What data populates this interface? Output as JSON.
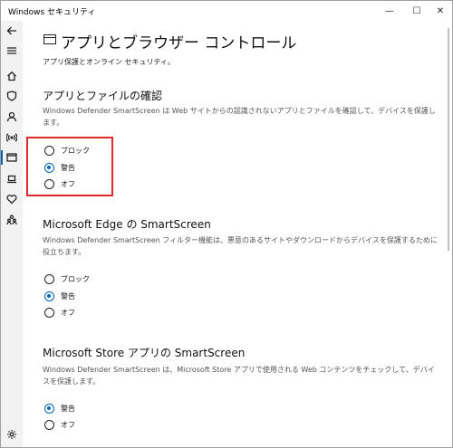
{
  "window": {
    "title": "Windows セキュリティ",
    "controls": {
      "minimize": "—",
      "maximize": "☐",
      "close": "✕"
    }
  },
  "sidebar": {
    "items": [
      {
        "icon": "back-arrow-icon"
      },
      {
        "icon": "hamburger-menu-icon"
      },
      {
        "icon": "home-icon"
      },
      {
        "icon": "shield-icon"
      },
      {
        "icon": "person-icon"
      },
      {
        "icon": "wireless-icon"
      },
      {
        "icon": "app-browser-icon",
        "active": true
      },
      {
        "icon": "laptop-icon"
      },
      {
        "icon": "heart-icon"
      },
      {
        "icon": "family-icon"
      },
      {
        "icon": "gear-icon"
      }
    ]
  },
  "page": {
    "title": "アプリとブラウザー コントロール",
    "subtitle": "アプリ保護とオンライン セキュリティ。"
  },
  "sections": [
    {
      "heading": "アプリとファイルの確認",
      "description": "Windows Defender SmartScreen は Web サイトからの認識されないアプリとファイルを確認して、デバイスを保護します。",
      "options": [
        {
          "label": "ブロック",
          "checked": false
        },
        {
          "label": "警告",
          "checked": true
        },
        {
          "label": "オフ",
          "checked": false
        }
      ]
    },
    {
      "heading": "Microsoft Edge の SmartScreen",
      "description": "Windows Defender SmartScreen フィルター機能は、悪意のあるサイトやダウンロードからデバイスを保護するために役立ちます。",
      "options": [
        {
          "label": "ブロック",
          "checked": false
        },
        {
          "label": "警告",
          "checked": true
        },
        {
          "label": "オフ",
          "checked": false
        }
      ]
    },
    {
      "heading": "Microsoft Store アプリの SmartScreen",
      "description": "Windows Defender SmartScreen は、Microsoft Store アプリで使用される Web コンテンツをチェックして、デバイスを保護します。",
      "options": [
        {
          "label": "警告",
          "checked": true
        },
        {
          "label": "オフ",
          "checked": false
        }
      ]
    }
  ],
  "colors": {
    "accent": "#0063b1",
    "highlight": "#e02a2a",
    "sidebar_bg": "#f2f2f2"
  }
}
